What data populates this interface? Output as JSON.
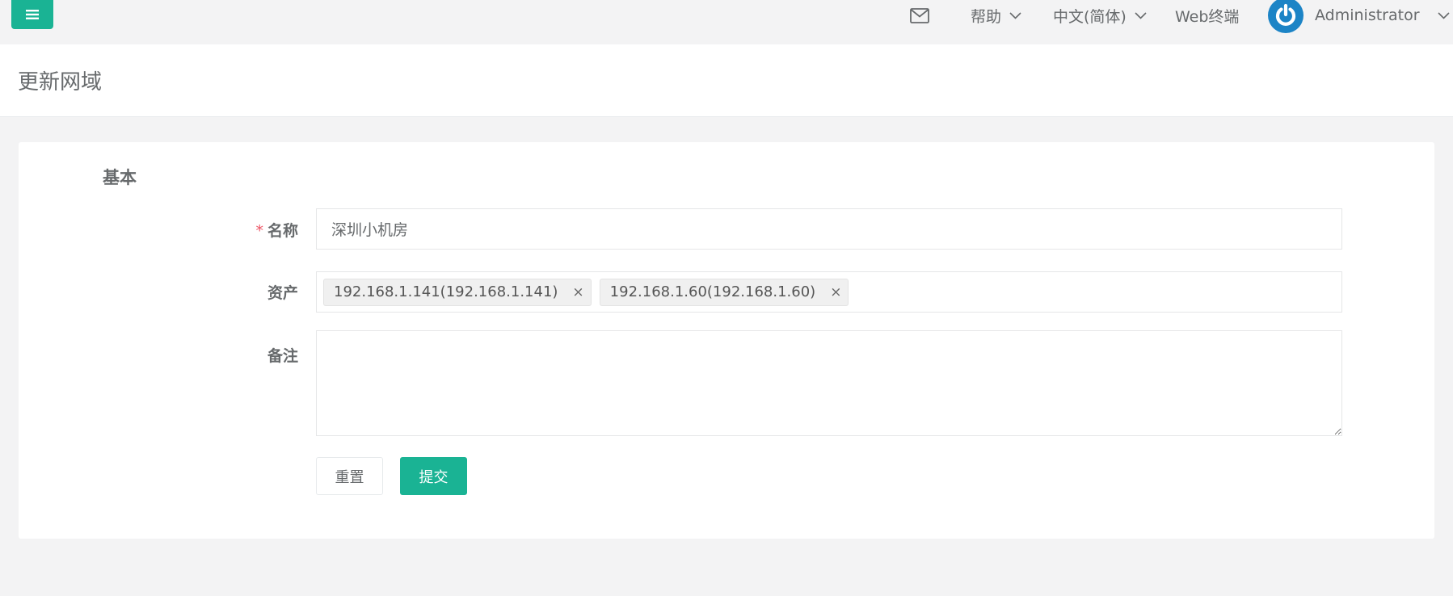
{
  "navbar": {
    "help_label": "帮助",
    "language_label": "中文(简体)",
    "web_terminal_label": "Web终端",
    "user_label": "Administrator",
    "accent_color": "#1ab394",
    "avatar_color": "#1c84c6"
  },
  "page": {
    "title": "更新网域"
  },
  "form": {
    "section_title": "基本",
    "name_label": "名称",
    "required_marker": "*",
    "name_value": "深圳小机房",
    "assets_label": "资产",
    "assets": [
      {
        "label": "192.168.1.141(192.168.1.141)"
      },
      {
        "label": "192.168.1.60(192.168.1.60)"
      }
    ],
    "tag_remove_glyph": "×",
    "remarks_label": "备注",
    "remarks_value": "",
    "reset_label": "重置",
    "submit_label": "提交"
  }
}
